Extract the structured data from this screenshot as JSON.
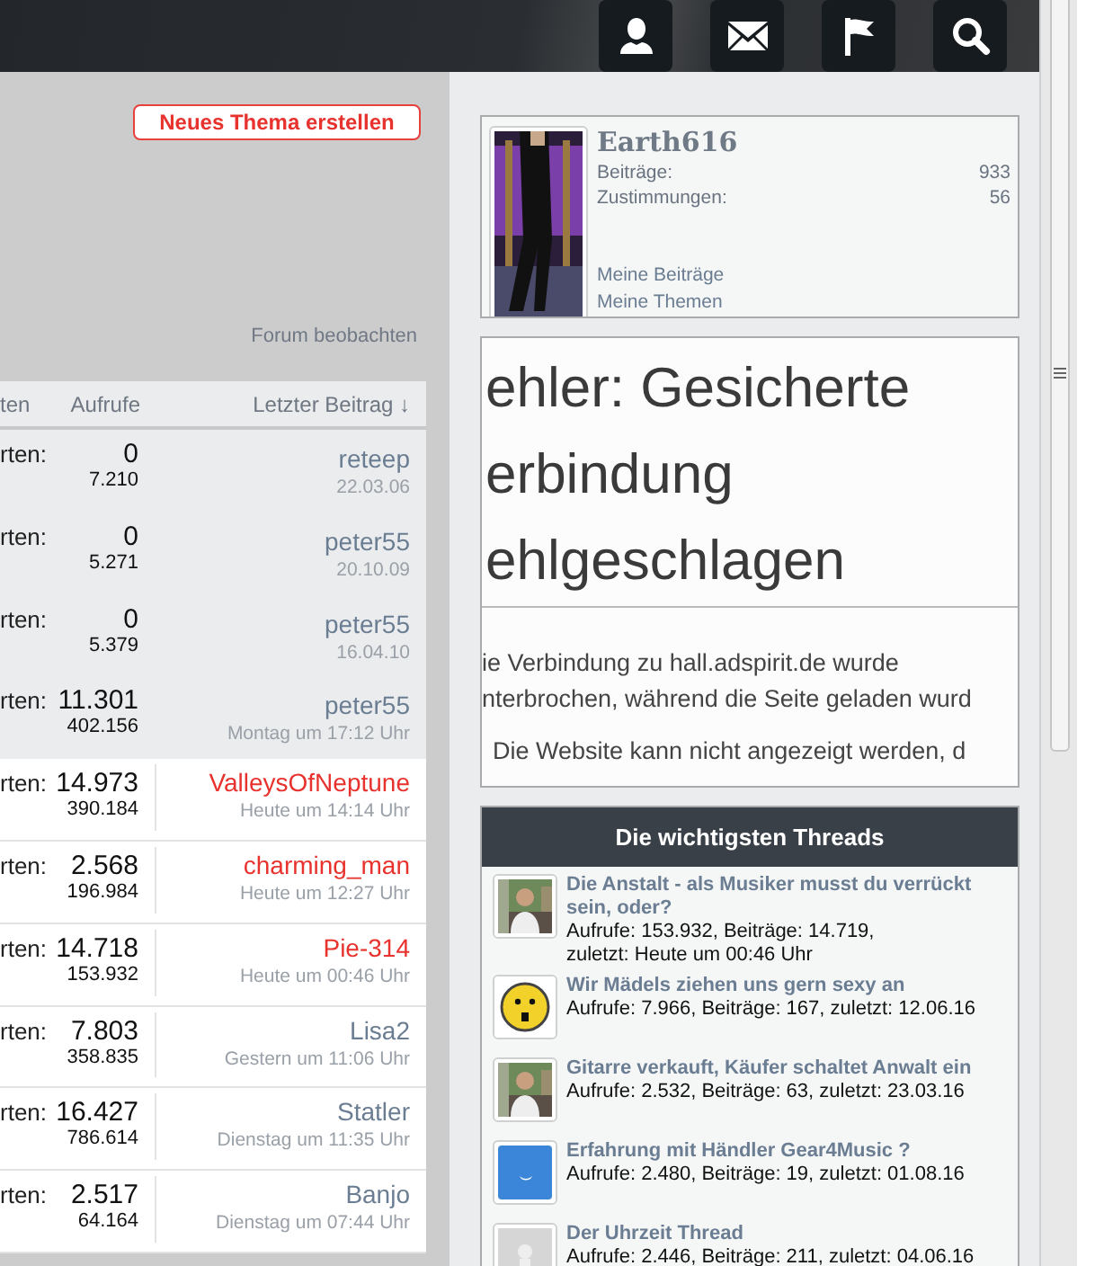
{
  "header": {
    "icon_buttons": [
      {
        "kind": "user"
      },
      {
        "kind": "mail"
      },
      {
        "kind": "flag"
      },
      {
        "kind": "search"
      }
    ]
  },
  "new_thread_button": "Neues Thema erstellen",
  "watch_forum_link": "Forum beobachten",
  "table": {
    "columns": [
      "ten",
      "Aufrufe",
      "Letzter Beitrag ↓"
    ],
    "rows": [
      {
        "label": "rten:",
        "replies": "0",
        "views": "7.210",
        "last_user": "reteep",
        "color": "#6a7d92",
        "last_time": "22.03.06",
        "pinned": true
      },
      {
        "label": "rten:",
        "replies": "0",
        "views": "5.271",
        "last_user": "peter55",
        "color": "#6a7d92",
        "last_time": "20.10.09",
        "pinned": true
      },
      {
        "label": "rten:",
        "replies": "0",
        "views": "5.379",
        "last_user": "peter55",
        "color": "#6a7d92",
        "last_time": "16.04.10",
        "pinned": true
      },
      {
        "label": "rten:",
        "replies": "11.301",
        "views": "402.156",
        "last_user": "peter55",
        "color": "#6a7d92",
        "last_time": "Montag um 17:12 Uhr",
        "pinned": true
      },
      {
        "label": "rten:",
        "replies": "14.973",
        "views": "390.184",
        "last_user": "ValleysOfNeptune",
        "color": "#e8322e",
        "last_time": "Heute um 14:14 Uhr",
        "pinned": false
      },
      {
        "label": "rten:",
        "replies": "2.568",
        "views": "196.984",
        "last_user": "charming_man",
        "color": "#e8322e",
        "last_time": "Heute um 12:27 Uhr",
        "pinned": false
      },
      {
        "label": "rten:",
        "replies": "14.718",
        "views": "153.932",
        "last_user": "Pie-314",
        "color": "#e8322e",
        "last_time": "Heute um 00:46 Uhr",
        "pinned": false
      },
      {
        "label": "rten:",
        "replies": "7.803",
        "views": "358.835",
        "last_user": "Lisa2",
        "color": "#6a7d92",
        "last_time": "Gestern um 11:06 Uhr",
        "pinned": false
      },
      {
        "label": "rten:",
        "replies": "16.427",
        "views": "786.614",
        "last_user": "Statler",
        "color": "#6a7d92",
        "last_time": "Dienstag um 11:35 Uhr",
        "pinned": false
      },
      {
        "label": "rten:",
        "replies": "2.517",
        "views": "64.164",
        "last_user": "Banjo",
        "color": "#6a7d92",
        "last_time": "Dienstag um 07:44 Uhr",
        "pinned": false
      }
    ]
  },
  "profile": {
    "username": "Earth616",
    "stats": [
      {
        "label": "Beiträge:",
        "value": "933"
      },
      {
        "label": "Zustimmungen:",
        "value": "56"
      }
    ],
    "links": [
      "Meine Beiträge",
      "Meine Themen"
    ]
  },
  "error_box": {
    "title_lines": [
      "ehler: Gesicherte",
      "erbindung",
      "ehlgeschlagen"
    ],
    "text_lines": [
      "ie Verbindung zu hall.adspirit.de wurde",
      "nterbrochen, während die Seite geladen wurd"
    ],
    "note": "Die Website kann nicht angezeigt werden, d"
  },
  "top_threads": {
    "title": "Die wichtigsten Threads",
    "items": [
      {
        "kind": "picture",
        "title": "Die Anstalt - als Musiker musst du verrückt sein, oder?",
        "stats": [
          "Aufrufe: 153.932, Beiträge: 14.719,",
          "zuletzt: Heute um 00:46 Uhr"
        ]
      },
      {
        "kind": "smiley",
        "title": "Wir Mädels ziehen uns gern sexy an",
        "stats": [
          "Aufrufe: 7.966, Beiträge: 167, zuletzt: 12.06.16"
        ]
      },
      {
        "kind": "picture",
        "title": "Gitarre verkauft, Käufer schaltet Anwalt ein",
        "stats": [
          "Aufrufe: 2.532, Beiträge: 63, zuletzt: 23.03.16"
        ]
      },
      {
        "kind": "moon",
        "title": "Erfahrung mit Händler Gear4Music ?",
        "stats": [
          "Aufrufe: 2.480, Beiträge: 19, zuletzt: 01.08.16"
        ]
      },
      {
        "kind": "placeholder",
        "title": "Der Uhrzeit Thread",
        "stats": [
          "Aufrufe: 2.446, Beiträge: 211, zuletzt: 04.06.16"
        ]
      }
    ]
  }
}
